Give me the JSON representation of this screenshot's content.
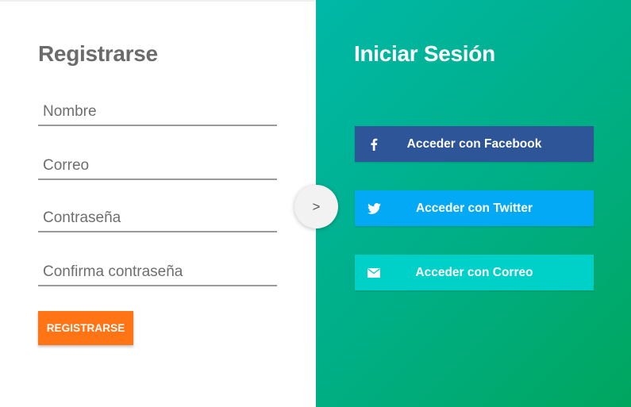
{
  "register": {
    "title": "Registrarse",
    "fields": [
      {
        "placeholder": "Nombre",
        "value": ""
      },
      {
        "placeholder": "Correo",
        "value": ""
      },
      {
        "placeholder": "Contraseña",
        "value": ""
      },
      {
        "placeholder": "Confirma contraseña",
        "value": ""
      }
    ],
    "submit_label": "REGISTRARSE"
  },
  "toggle": {
    "label": ">"
  },
  "login": {
    "title": "Iniciar Sesión",
    "buttons": [
      {
        "label": "Acceder con Facebook",
        "icon": "facebook-icon",
        "color": "#2e5597"
      },
      {
        "label": "Acceder con Twitter",
        "icon": "twitter-icon",
        "color": "#03a9f4"
      },
      {
        "label": "Acceder con Correo",
        "icon": "mail-icon",
        "color": "#00d1c8"
      }
    ]
  },
  "colors": {
    "register_button": "#ff7414",
    "panel_gradient_start": "#00b8a8",
    "panel_gradient_end": "#00a65e"
  }
}
